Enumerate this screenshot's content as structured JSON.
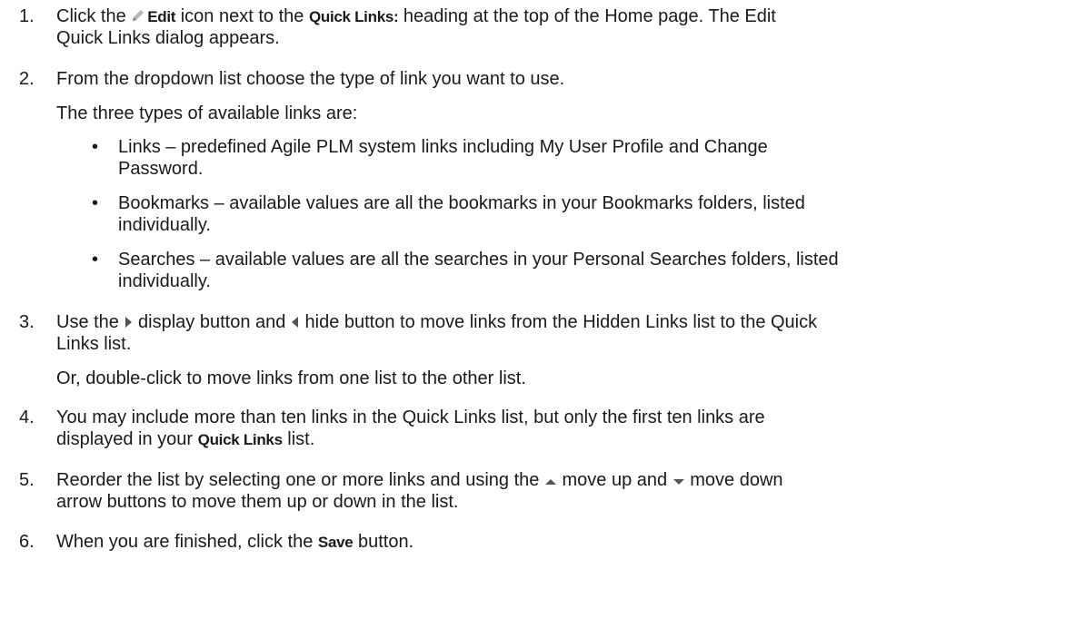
{
  "steps": [
    {
      "num": "1.",
      "p1": "Click the ",
      "edit_label": "Edit",
      "p2": " icon next to the ",
      "quick_links_label": "Quick Links:",
      "p3": " heading at the top of the Home page. The Edit",
      "line2": "Quick Links dialog appears."
    },
    {
      "num": "2.",
      "line1": "From the dropdown list choose the type of link you want to use.",
      "intro": "The three types of available links are:",
      "bullets": [
        {
          "l1": "Links – predefined Agile PLM system links including My User Profile and Change",
          "l2": "Password."
        },
        {
          "l1": "Bookmarks – available values are all the bookmarks in your Bookmarks folders, listed",
          "l2": "individually."
        },
        {
          "l1": "Searches – available values are all the searches in your Personal Searches folders, listed",
          "l2": "individually."
        }
      ]
    },
    {
      "num": "3.",
      "p1": "Use the ",
      "p2": " display button and ",
      "p3": " hide button to move links from the Hidden Links list to the Quick",
      "line2": "Links list.",
      "note": "Or, double-click to move links from one list to the other list."
    },
    {
      "num": "4.",
      "line1": "You may include more than ten links in the Quick Links list, but only the first ten links are",
      "p1": "displayed in your ",
      "quick_links_label": "Quick Links",
      "p2": " list."
    },
    {
      "num": "5.",
      "p1": "Reorder the list by selecting one or more links and using the ",
      "p2": " move up and ",
      "p3": " move down",
      "line2": "arrow buttons to move them up or down in the list."
    },
    {
      "num": "6.",
      "p1": "When you are finished, click the ",
      "save_label": "Save",
      "p2": " button."
    }
  ],
  "icons": {
    "edit": "pencil-icon",
    "display": "triangle-right-icon",
    "hide": "triangle-left-icon",
    "up": "triangle-up-icon",
    "down": "triangle-down-icon",
    "bullet": "bullet-icon"
  },
  "colors": {
    "text": "#1a1a1a",
    "icon": "#777777"
  }
}
